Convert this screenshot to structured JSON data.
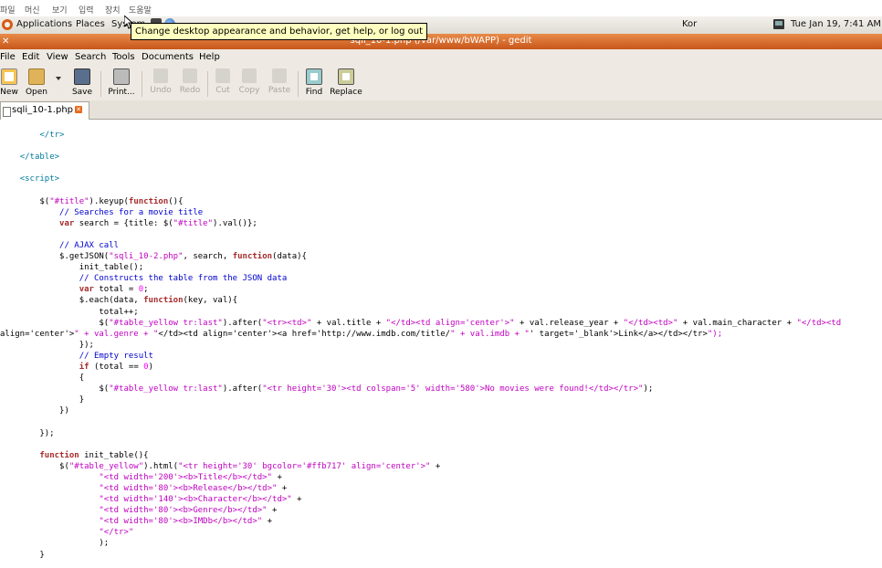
{
  "host_menu": [
    "파일",
    "머신",
    "보기",
    "입력",
    "장치",
    "도움말"
  ],
  "panel": {
    "applications": "Applications",
    "places": "Places",
    "system": "System",
    "keyboard_layout": "Kor",
    "clock": "Tue Jan 19,  7:41 AM"
  },
  "tooltip": "Change desktop appearance and behavior, get help, or log out",
  "window": {
    "title": "sqli_10-1.php (/var/www/bWAPP) - gedit"
  },
  "menubar": [
    "File",
    "Edit",
    "View",
    "Search",
    "Tools",
    "Documents",
    "Help"
  ],
  "toolbar": [
    "New",
    "Open",
    "Save",
    "Print...",
    "Undo",
    "Redo",
    "Cut",
    "Copy",
    "Paste",
    "Find",
    "Replace"
  ],
  "tab": {
    "label": "sqli_10-1.php"
  },
  "code_lines": [
    "        </tr>",
    "",
    "    </table>",
    "",
    "    <script>",
    "",
    "        $(\"#title\").keyup(function(){",
    "            // Searches for a movie title",
    "            var search = {title: $(\"#title\").val()};",
    "",
    "            // AJAX call",
    "            $.getJSON(\"sqli_10-2.php\", search, function(data){",
    "                init_table();",
    "                // Constructs the table from the JSON data",
    "                var total = 0;",
    "                $.each(data, function(key, val){",
    "                    total++;",
    "                    $(\"#table_yellow tr:last\").after(\"<tr><td>\" + val.title + \"</td><td align='center'>\" + val.release_year + \"</td><td>\" + val.main_character + \"</td><td",
    "align='center'>\" + val.genre + \"</td><td align='center'><a href='http://www.imdb.com/title/\" + val.imdb + \"' target='_blank'>Link</a></td></tr>\");",
    "                });",
    "                // Empty result",
    "                if (total == 0)",
    "                {",
    "                    $(\"#table_yellow tr:last\").after(\"<tr height='30'><td colspan='5' width='580'>No movies were found!</td></tr>\");",
    "                }",
    "            })",
    "",
    "        });",
    "",
    "        function init_table(){",
    "            $(\"#table_yellow\").html(\"<tr height='30' bgcolor='#ffb717' align='center'>\" +",
    "                    \"<td width='200'><b>Title</b></td>\" +",
    "                    \"<td width='80'><b>Release</b></td>\" +",
    "                    \"<td width='140'><b>Character</b></td>\" +",
    "                    \"<td width='80'><b>Genre</b></td>\" +",
    "                    \"<td width='80'><b>IMDb</b></td>\" +",
    "                    \"</tr>\"",
    "                    );",
    "        }"
  ]
}
